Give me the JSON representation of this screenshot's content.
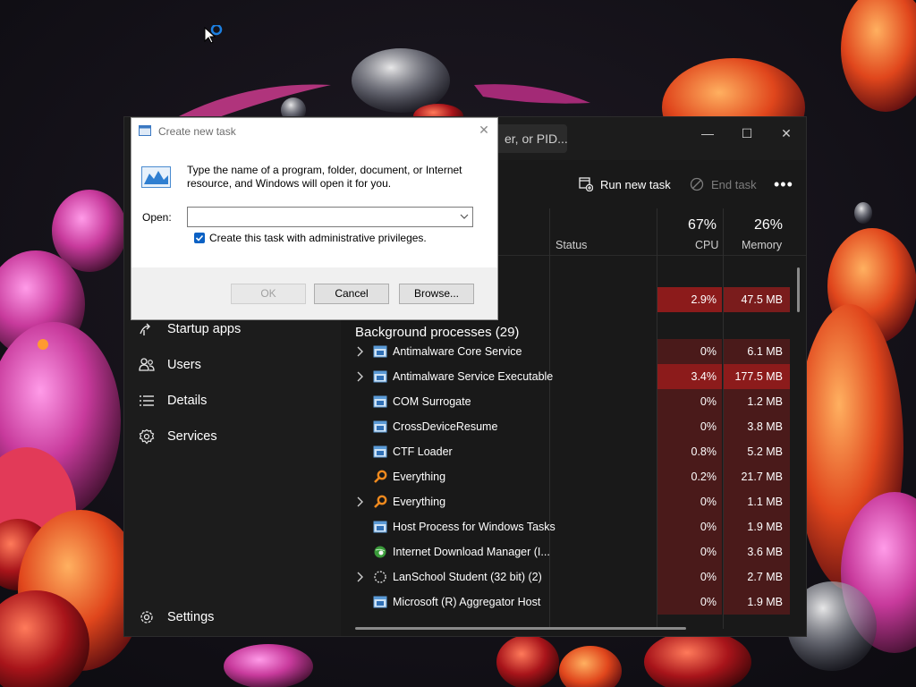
{
  "taskmgr": {
    "search_placeholder": "er, or PID...",
    "window_controls": {
      "minimize": "—",
      "maximize": "☐",
      "close": "✕"
    },
    "sidebar": {
      "items": [
        {
          "label": "Startup apps",
          "icon": "startup-apps-icon"
        },
        {
          "label": "Users",
          "icon": "users-icon"
        },
        {
          "label": "Details",
          "icon": "details-icon"
        },
        {
          "label": "Services",
          "icon": "services-icon"
        }
      ],
      "settings_label": "Settings"
    },
    "toolbar": {
      "run_new_task": "Run new task",
      "end_task": "End task",
      "more": "•••"
    },
    "columns": {
      "status": "Status",
      "cpu_pct": "67%",
      "cpu": "CPU",
      "mem_pct": "26%",
      "memory": "Memory"
    },
    "app_row": {
      "cpu": "2.9%",
      "mem": "47.5 MB"
    },
    "background_title": "Background processes (29)",
    "processes": [
      {
        "name": "Antimalware Core Service",
        "cpu": "0%",
        "mem": "6.1 MB",
        "expandable": true,
        "icon": "window-app-icon"
      },
      {
        "name": "Antimalware Service Executable",
        "cpu": "3.4%",
        "mem": "177.5 MB",
        "expandable": true,
        "icon": "window-app-icon"
      },
      {
        "name": "COM Surrogate",
        "cpu": "0%",
        "mem": "1.2 MB",
        "expandable": false,
        "icon": "window-app-icon"
      },
      {
        "name": "CrossDeviceResume",
        "cpu": "0%",
        "mem": "3.8 MB",
        "expandable": false,
        "icon": "window-app-icon"
      },
      {
        "name": "CTF Loader",
        "cpu": "0.8%",
        "mem": "5.2 MB",
        "expandable": false,
        "icon": "window-app-icon"
      },
      {
        "name": "Everything",
        "cpu": "0.2%",
        "mem": "21.7 MB",
        "expandable": false,
        "icon": "magnifier-icon"
      },
      {
        "name": "Everything",
        "cpu": "0%",
        "mem": "1.1 MB",
        "expandable": true,
        "icon": "magnifier-icon"
      },
      {
        "name": "Host Process for Windows Tasks",
        "cpu": "0%",
        "mem": "1.9 MB",
        "expandable": false,
        "icon": "window-app-icon"
      },
      {
        "name": "Internet Download Manager (I...",
        "cpu": "0%",
        "mem": "3.6 MB",
        "expandable": false,
        "icon": "idm-globe-icon"
      },
      {
        "name": "LanSchool Student (32 bit) (2)",
        "cpu": "0%",
        "mem": "2.7 MB",
        "expandable": true,
        "icon": "lanschool-icon"
      },
      {
        "name": "Microsoft (R) Aggregator Host",
        "cpu": "0%",
        "mem": "1.9 MB",
        "expandable": false,
        "icon": "window-app-icon"
      }
    ]
  },
  "dialog": {
    "title": "Create new task",
    "close": "✕",
    "description": "Type the name of a program, folder, document, or Internet resource, and Windows will open it for you.",
    "open_label": "Open:",
    "open_value": "",
    "admin_checkbox_label": "Create this task with administrative privileges.",
    "admin_checked": true,
    "ok": "OK",
    "cancel": "Cancel",
    "browse": "Browse..."
  }
}
